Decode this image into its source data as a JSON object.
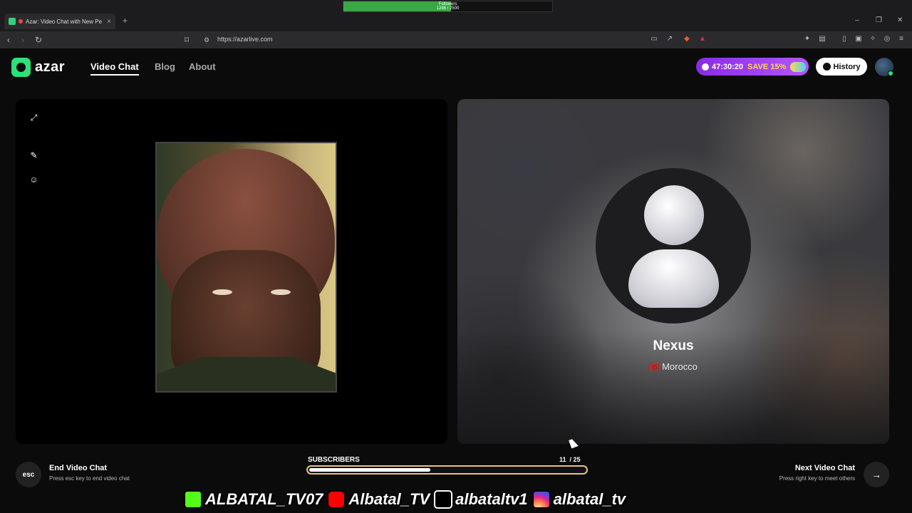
{
  "browser": {
    "tab_title": "Azar: Video Chat with New Pe",
    "new_tab": "+",
    "close_tab": "×",
    "url": "https://azarlive.com",
    "window_controls": [
      "–",
      "❐",
      "✕"
    ]
  },
  "stream_overlay": {
    "followers_label": "Followers",
    "followers_value": "1286 / 2500",
    "followers_progress": 0.514,
    "subscribers_label": "SUBSCRIBERS",
    "subscribers_value": "11",
    "subscribers_goal": "/ 25",
    "subscribers_progress": 0.44,
    "socials": [
      {
        "icon": "kick-icon",
        "handle": "ALBATAL_TV07"
      },
      {
        "icon": "youtube-icon",
        "handle": "Albatal_TV"
      },
      {
        "icon": "tiktok-icon",
        "handle": "albataltv1"
      },
      {
        "icon": "instagram-icon",
        "handle": "albatal_tv"
      }
    ]
  },
  "header": {
    "logo_text": "azar",
    "nav": {
      "video_chat": "Video Chat",
      "blog": "Blog",
      "about": "About"
    },
    "promo": {
      "timer": "47:30:20",
      "save": "SAVE 15%"
    },
    "history_label": "History"
  },
  "peer": {
    "name": "Nexus",
    "country": "Morocco"
  },
  "controls": {
    "esc_label": "esc",
    "end_title": "End Video Chat",
    "end_hint": "Press esc key to end video chat",
    "next_title": "Next Video Chat",
    "next_hint": "Press right key to meet others",
    "next_arrow": "→"
  },
  "colors": {
    "brand_green": "#2ee07a",
    "promo_purple": "#a040f0",
    "promo_accent": "#ffd84a",
    "subs_border": "#e8c47a"
  }
}
